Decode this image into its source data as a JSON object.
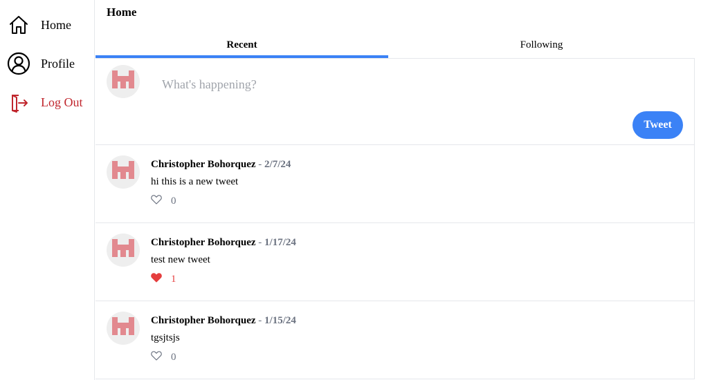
{
  "sidebar": {
    "items": [
      {
        "label": "Home",
        "icon": "home-icon"
      },
      {
        "label": "Profile",
        "icon": "user-circle-icon"
      },
      {
        "label": "Log Out",
        "icon": "logout-icon",
        "color": "#c0262d"
      }
    ]
  },
  "header": {
    "title": "Home"
  },
  "tabs": [
    {
      "label": "Recent",
      "active": true
    },
    {
      "label": "Following",
      "active": false
    }
  ],
  "composer": {
    "placeholder": "What's happening?",
    "button_label": "Tweet"
  },
  "tweets": [
    {
      "author": "Christopher Bohorquez",
      "separator": " - ",
      "date": "2/7/24",
      "text": "hi this is a new tweet",
      "likes": "0",
      "liked": false
    },
    {
      "author": "Christopher Bohorquez",
      "separator": " - ",
      "date": "1/17/24",
      "text": "test new tweet",
      "likes": "1",
      "liked": true
    },
    {
      "author": "Christopher Bohorquez",
      "separator": " - ",
      "date": "1/15/24",
      "text": "tgsjtsjs",
      "likes": "0",
      "liked": false
    }
  ],
  "colors": {
    "accent": "#3b82f6",
    "logout": "#c0262d",
    "like_active": "#e53e3e",
    "avatar_pattern": "#e2898f"
  }
}
